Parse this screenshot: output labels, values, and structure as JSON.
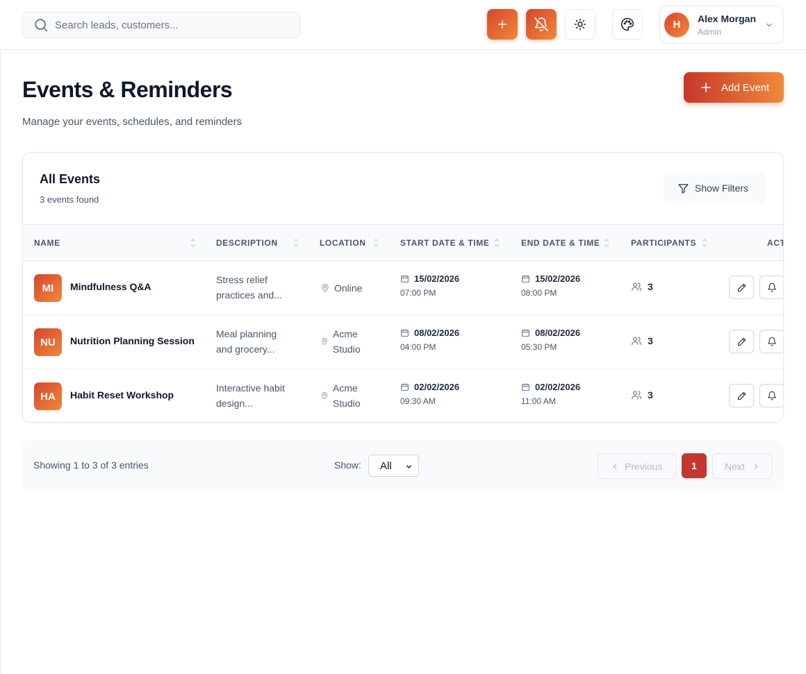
{
  "header": {
    "search_placeholder": "Search leads, customers...",
    "user": {
      "initial": "H",
      "name": "Alex Morgan",
      "role": "Admin"
    }
  },
  "page": {
    "title": "Events & Reminders",
    "subtitle": "Manage your events, schedules, and reminders",
    "add_button": "Add Event"
  },
  "card": {
    "title": "All Events",
    "count": "3 events found",
    "filter_button": "Show Filters"
  },
  "table": {
    "columns": [
      "NAME",
      "DESCRIPTION",
      "LOCATION",
      "START DATE & TIME",
      "END DATE & TIME",
      "PARTICIPANTS",
      "ACT"
    ],
    "rows": [
      {
        "initials": "MI",
        "name": "Mindfulness Q&A",
        "desc_1": "Stress relief",
        "desc_2": "practices and...",
        "loc_1": "Online",
        "loc_2": "",
        "start_date": "15/02/2026",
        "start_time": "07:00 PM",
        "end_date": "15/02/2026",
        "end_time": "08:00 PM",
        "participants": "3"
      },
      {
        "initials": "NU",
        "name": "Nutrition Planning Session",
        "desc_1": "Meal planning",
        "desc_2": "and grocery...",
        "loc_1": "Acme",
        "loc_2": "Studio",
        "start_date": "08/02/2026",
        "start_time": "04:00 PM",
        "end_date": "08/02/2026",
        "end_time": "05:30 PM",
        "participants": "3"
      },
      {
        "initials": "HA",
        "name": "Habit Reset Workshop",
        "desc_1": "Interactive habit",
        "desc_2": "design...",
        "loc_1": "Acme",
        "loc_2": "Studio",
        "start_date": "02/02/2026",
        "start_time": "09:30 AM",
        "end_date": "02/02/2026",
        "end_time": "11:00 AM",
        "participants": "3"
      }
    ]
  },
  "pagination": {
    "showing": "Showing 1 to 3 of 3 entries",
    "show_label": "Show:",
    "show_value": "All",
    "previous": "Previous",
    "current_page": "1",
    "next": "Next"
  },
  "colors": {
    "accent_start": "#d9442e",
    "accent_end": "#ee8a3a",
    "active_page": "#c4362e"
  },
  "icons": [
    "search-icon",
    "plus-icon",
    "bell-off-icon",
    "sun-icon",
    "palette-icon",
    "chevron-down-icon",
    "filter-icon",
    "sort-icon",
    "map-pin-icon",
    "calendar-icon",
    "users-icon",
    "pencil-icon",
    "bell-icon",
    "chevron-left-icon",
    "chevron-right-icon"
  ]
}
